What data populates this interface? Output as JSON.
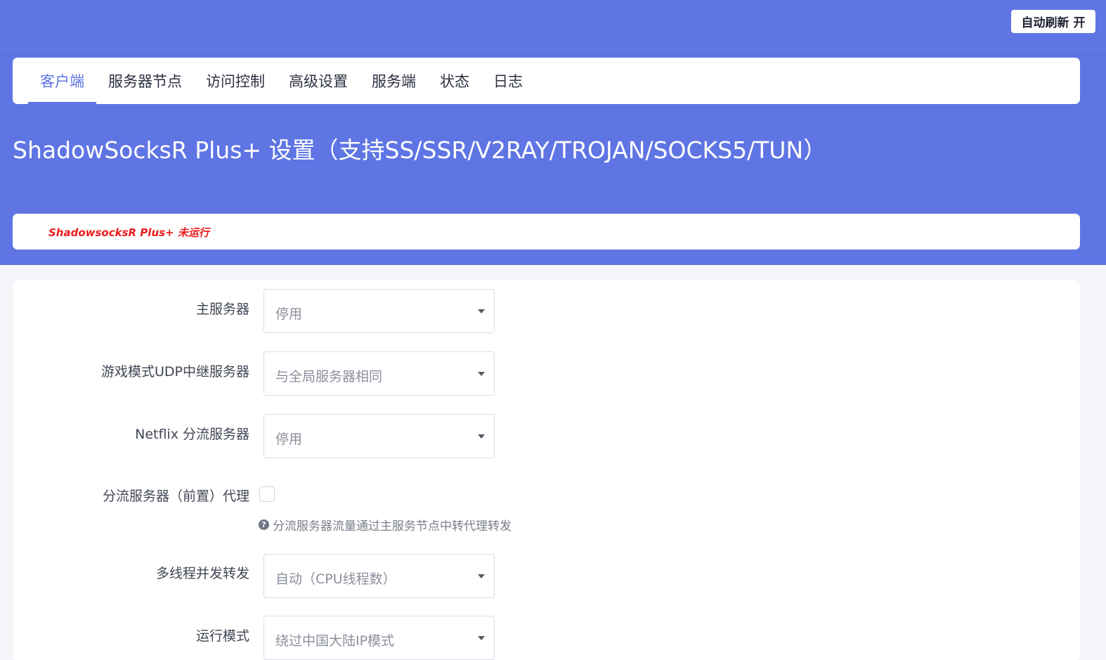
{
  "header": {
    "refresh_label": "自动刷新 开"
  },
  "tabs": [
    {
      "label": "客户端",
      "active": true
    },
    {
      "label": "服务器节点",
      "active": false
    },
    {
      "label": "访问控制",
      "active": false
    },
    {
      "label": "高级设置",
      "active": false
    },
    {
      "label": "服务端",
      "active": false
    },
    {
      "label": "状态",
      "active": false
    },
    {
      "label": "日志",
      "active": false
    }
  ],
  "page": {
    "title": "ShadowSocksR Plus+ 设置（支持SS/SSR/V2RAY/TROJAN/SOCKS5/TUN）",
    "status": "ShadowsocksR Plus+ 未运行"
  },
  "form": {
    "main_server": {
      "label": "主服务器",
      "value": "停用"
    },
    "udp_server": {
      "label": "游戏模式UDP中继服务器",
      "value": "与全局服务器相同"
    },
    "netflix_server": {
      "label": "Netflix 分流服务器",
      "value": "停用"
    },
    "shunt_proxy": {
      "label": "分流服务器（前置）代理",
      "checked": false,
      "help": "分流服务器流量通过主服务节点中转代理转发"
    },
    "threads": {
      "label": "多线程并发转发",
      "value": "自动（CPU线程数）"
    },
    "run_mode": {
      "label": "运行模式",
      "value": "绕过中国大陆IP模式"
    }
  },
  "colors": {
    "accent": "#5f75e4",
    "status_red": "#ee1c1c"
  }
}
